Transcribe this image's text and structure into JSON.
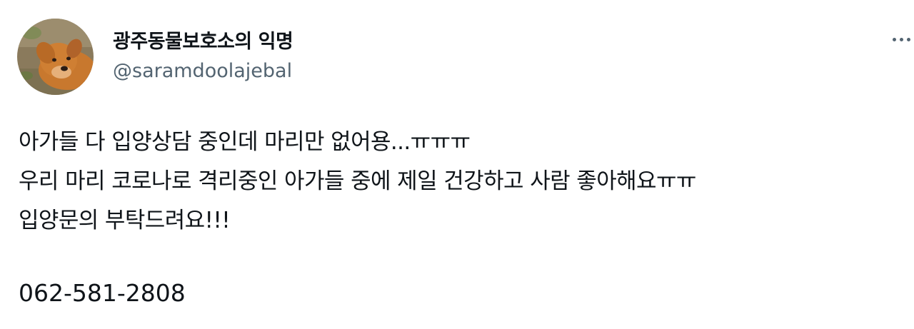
{
  "user": {
    "display_name": "광주동물보호소의 익명",
    "handle": "@saramdoolajebal",
    "avatar_icon": "dog-photo-avatar"
  },
  "menu": {
    "icon": "more-options-icon"
  },
  "tweet": {
    "lines": [
      "아가들 다 입양상담 중인데 마리만 없어용...ㅠㅠㅠ",
      "우리 마리 코로나로 격리중인 아가들 중에 제일 건강하고 사람 좋아해요ㅠㅠ",
      "입양문의 부탁드려요!!!"
    ],
    "phone": "062-581-2808"
  },
  "colors": {
    "text": "#0f1419",
    "secondary_text": "#536471",
    "background": "#ffffff"
  }
}
